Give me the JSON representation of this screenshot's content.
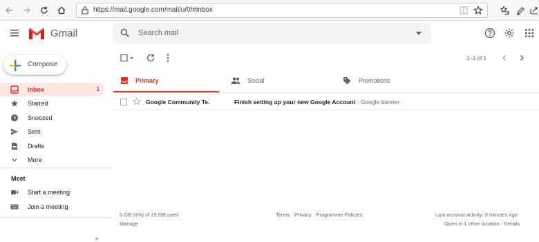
{
  "browser": {
    "url": "https://mail.google.com/mail/u/0/#inbox"
  },
  "app": {
    "name": "Gmail"
  },
  "search": {
    "placeholder": "Search mail"
  },
  "compose": {
    "label": "Compose"
  },
  "sidebar": {
    "items": [
      {
        "label": "Inbox",
        "count": "1",
        "icon": "inbox-icon"
      },
      {
        "label": "Starred",
        "icon": "star-icon"
      },
      {
        "label": "Snoozed",
        "icon": "clock-icon"
      },
      {
        "label": "Sent",
        "icon": "send-icon"
      },
      {
        "label": "Drafts",
        "icon": "draft-icon"
      },
      {
        "label": "More",
        "icon": "chevron-down-icon"
      }
    ],
    "meet": {
      "title": "Meet",
      "items": [
        {
          "label": "Start a meeting",
          "icon": "video-icon"
        },
        {
          "label": "Join a meeting",
          "icon": "keyboard-icon"
        }
      ]
    }
  },
  "toolbar": {
    "pagination": "1–1 of 1"
  },
  "tabs": [
    {
      "label": "Primary",
      "icon": "inbox-icon"
    },
    {
      "label": "Social",
      "icon": "people-icon"
    },
    {
      "label": "Promotions",
      "icon": "tag-icon"
    }
  ],
  "messages": [
    {
      "sender": "Google Community Te.",
      "subject": "Finish setting up your new Google Account",
      "separator": " - ",
      "snippet": "Google banner"
    }
  ],
  "footer": {
    "storage": "0 GB (0%) of 15 GB used",
    "manage": "Manage",
    "links": "Terms · Privacy · Programme Policies",
    "activity": "Last account activity: 0 minutes ago",
    "details": "Open in 1 other location · Details"
  },
  "colors": {
    "accent": "#d93025",
    "active_bg": "#fce8e6",
    "search_bg": "#f1f3f4"
  }
}
